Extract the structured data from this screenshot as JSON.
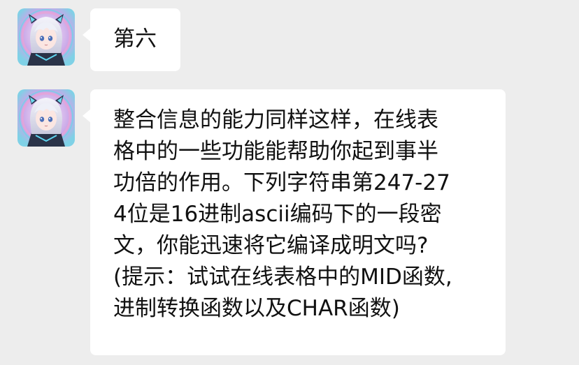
{
  "messages": [
    {
      "sender": "assistant",
      "avatar_icon": "anime-robot-girl-avatar-icon",
      "text": "第六"
    },
    {
      "sender": "assistant",
      "avatar_icon": "anime-robot-girl-avatar-icon",
      "lines": [
        "整合信息的能力同样这样，在线表",
        "格中的一些功能能帮助你起到事半",
        "功倍的作用。下列字符串第247-27",
        "4位是16进制ascii编码下的一段密",
        "文，你能迅速将它编译成明文吗?",
        "(提示：试试在线表格中的MID函数,",
        "进制转换函数以及CHAR函数)"
      ]
    }
  ],
  "colors": {
    "background": "#ededed",
    "bubble": "#ffffff",
    "text": "#111111",
    "avatar_glow_pink": "#e9a3d6",
    "avatar_glow_cyan": "#68d7e8"
  }
}
